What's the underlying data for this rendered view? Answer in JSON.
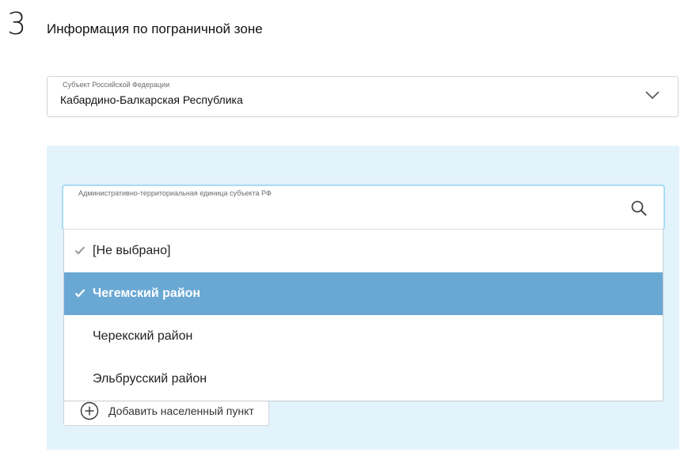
{
  "step": {
    "number": "3",
    "title": "Информация по пограничной зоне"
  },
  "region": {
    "label": "Субъект Российской Федерации",
    "value": "Кабардино-Балкарская Республика",
    "chevron_icon": "chevron-down-icon"
  },
  "admin_unit": {
    "label": "Административно-территориальная единица субъекта РФ",
    "value": "",
    "search_icon": "search-icon",
    "options": [
      {
        "label": "[Не выбрано]",
        "checked": true,
        "selected": false
      },
      {
        "label": "Чегемский район",
        "checked": true,
        "selected": true
      },
      {
        "label": "Черекский район",
        "checked": false,
        "selected": false
      },
      {
        "label": "Эльбрусский район",
        "checked": false,
        "selected": false
      }
    ]
  },
  "add_locality": {
    "label": "Добавить населенный пункт",
    "icon": "plus-circle-icon"
  },
  "colors": {
    "panel_bg": "#e3f3fc",
    "selected_option_bg": "#6aa8d4",
    "focus_border": "#a8dcf4",
    "check_muted": "#9aa0a6"
  }
}
